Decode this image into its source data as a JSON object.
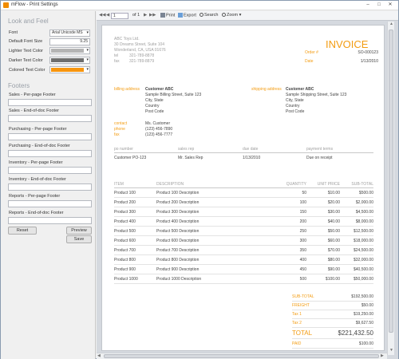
{
  "window": {
    "title": "mFlow - Print Settings"
  },
  "look_and_feel": {
    "heading": "Look and Feel",
    "font_label": "Font",
    "font_value": "Arial Unicode MS",
    "default_font_size_label": "Default Font Size",
    "default_font_size_value": "9.25",
    "lighter_text_color_label": "Lighter Text Color",
    "darker_text_color_label": "Darker Text Color",
    "colored_text_color_label": "Colored Text Color",
    "colors": {
      "lighter": "#b4b4b4",
      "darker": "#6e6e6e",
      "colored": "#f7950e"
    }
  },
  "footers": {
    "heading": "Footers",
    "items": [
      {
        "label": "Sales - Per-page Footer",
        "value": ""
      },
      {
        "label": "Sales - End-of-doc Footer",
        "value": ""
      },
      {
        "label": "Purchasing - Per-page Footer",
        "value": ""
      },
      {
        "label": "Purchasing - End-of-doc Footer",
        "value": ""
      },
      {
        "label": "Inventory - Per-page Footer",
        "value": ""
      },
      {
        "label": "Inventory - End-of-doc Footer",
        "value": ""
      },
      {
        "label": "Reports - Per-page Footer",
        "value": ""
      },
      {
        "label": "Reports - End-of-doc Footer",
        "value": ""
      }
    ]
  },
  "buttons": {
    "reset": "Reset",
    "preview": "Preview",
    "save": "Save"
  },
  "toolbar": {
    "page_value": "1",
    "of_label": "of 1",
    "print": "Print",
    "export": "Export",
    "search": "Search",
    "zoom": "Zoom"
  },
  "invoice": {
    "company": {
      "name": "ABC Toys Ltd.",
      "address1": "30 Dreams Street, Suite 104",
      "address2": "Wonderland, CA, USA 01676",
      "tel_label": "tel",
      "tel": "321-789-8878",
      "fax_label": "fax",
      "fax": "321-789-8879"
    },
    "title": "INVOICE",
    "number_label": "Order #",
    "number": "SO-000123",
    "date_label": "Date",
    "date": "1/13/2010",
    "billing_label": "billing address",
    "billing": [
      "Customer ABC",
      "Sample Billing Street, Suite 123",
      "City, State",
      "Country",
      "Post Code"
    ],
    "shipping_label": "shipping address",
    "shipping": [
      "Customer ABC",
      "Sample Shipping Street, Suite 123",
      "City, State",
      "Country",
      "Post Code"
    ],
    "contact_label": "contact",
    "contact": "Ms. Customer",
    "phone_label": "phone",
    "phone": "(123) 456-7890",
    "fax2_label": "fax",
    "fax2": "(123) 456-7777",
    "meta_headers": {
      "po": "po number",
      "rep": "sales rep",
      "due": "due date",
      "terms": "payment terms"
    },
    "meta_values": {
      "po": "Customer PO-123",
      "rep": "Mr. Sales Rep",
      "due": "1/13/2010",
      "terms": "Due on receipt"
    },
    "columns": {
      "item": "ITEM",
      "desc": "DESCRIPTION",
      "qty": "QUANTITY",
      "price": "UNIT PRICE",
      "total": "SUB-TOTAL"
    },
    "lines": [
      {
        "item": "Product 100",
        "desc": "Product 100 Description",
        "qty": "50",
        "price": "$10.00",
        "total": "$500.00"
      },
      {
        "item": "Product 200",
        "desc": "Product 200 Description",
        "qty": "100",
        "price": "$20.00",
        "total": "$2,000.00"
      },
      {
        "item": "Product 300",
        "desc": "Product 300 Description",
        "qty": "150",
        "price": "$30.00",
        "total": "$4,500.00"
      },
      {
        "item": "Product 400",
        "desc": "Product 400 Description",
        "qty": "200",
        "price": "$40.00",
        "total": "$8,000.00"
      },
      {
        "item": "Product 500",
        "desc": "Product 500 Description",
        "qty": "250",
        "price": "$50.00",
        "total": "$12,500.00"
      },
      {
        "item": "Product 600",
        "desc": "Product 600 Description",
        "qty": "300",
        "price": "$60.00",
        "total": "$18,000.00"
      },
      {
        "item": "Product 700",
        "desc": "Product 700 Description",
        "qty": "350",
        "price": "$70.00",
        "total": "$24,500.00"
      },
      {
        "item": "Product 800",
        "desc": "Product 800 Description",
        "qty": "400",
        "price": "$80.00",
        "total": "$32,000.00"
      },
      {
        "item": "Product 900",
        "desc": "Product 900 Description",
        "qty": "450",
        "price": "$90.00",
        "total": "$40,500.00"
      },
      {
        "item": "Product 1000",
        "desc": "Product 1000 Description",
        "qty": "500",
        "price": "$100.00",
        "total": "$50,000.00"
      }
    ],
    "totals": [
      {
        "label": "SUB-TOTAL",
        "value": "$192,500.00",
        "big": false
      },
      {
        "label": "FREIGHT",
        "value": "$50.00",
        "big": false
      },
      {
        "label": "Tax 1",
        "value": "$19,250.00",
        "big": false
      },
      {
        "label": "Tax 2",
        "value": "$9,627.50",
        "big": false
      },
      {
        "label": "TOTAL",
        "value": "$221,432.50",
        "big": true
      },
      {
        "label": "PAID",
        "value": "$100.00",
        "big": false
      },
      {
        "label": "BALANCE",
        "value": "$221,332.50",
        "big": true
      }
    ]
  }
}
